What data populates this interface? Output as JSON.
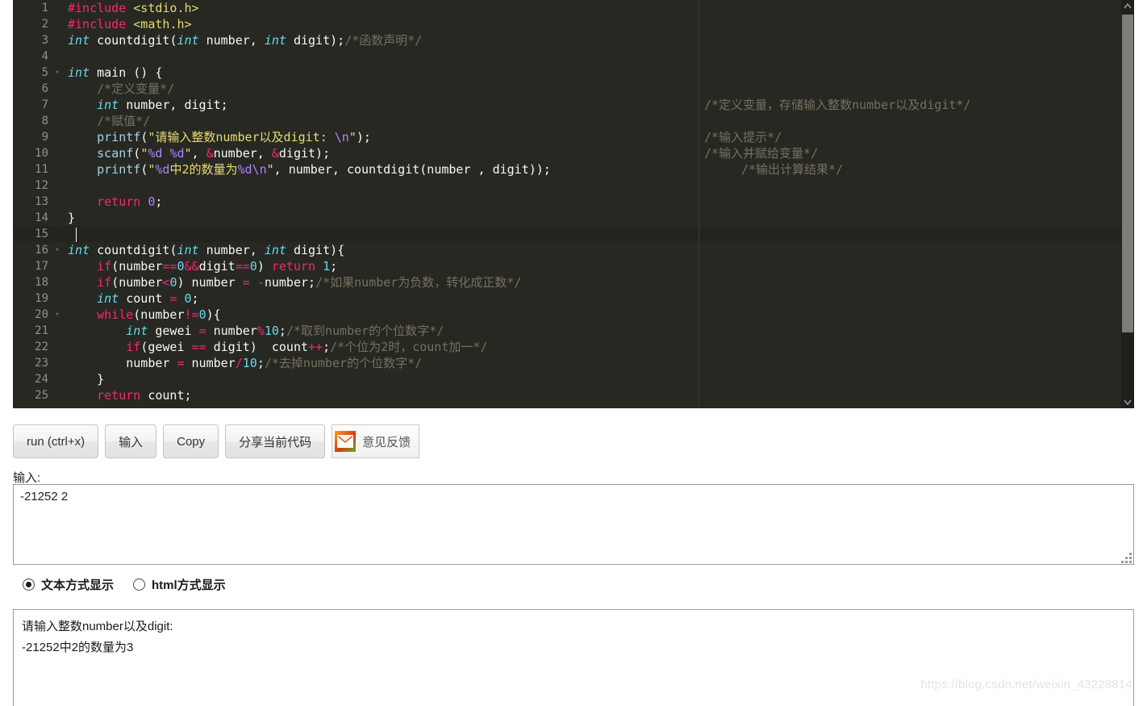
{
  "editor": {
    "background": "#272822",
    "gutter_color": "#8f908a",
    "active_line": 15,
    "first_line": 1,
    "last_visible_line": 25,
    "lines": [
      {
        "n": 1,
        "fold": false,
        "indent": 0
      },
      {
        "n": 2,
        "fold": false,
        "indent": 0
      },
      {
        "n": 3,
        "fold": false,
        "indent": 0
      },
      {
        "n": 4,
        "fold": false,
        "indent": 0
      },
      {
        "n": 5,
        "fold": true,
        "indent": 0
      },
      {
        "n": 6,
        "fold": false,
        "indent": 1
      },
      {
        "n": 7,
        "fold": false,
        "indent": 1
      },
      {
        "n": 8,
        "fold": false,
        "indent": 1
      },
      {
        "n": 9,
        "fold": false,
        "indent": 1
      },
      {
        "n": 10,
        "fold": false,
        "indent": 1
      },
      {
        "n": 11,
        "fold": false,
        "indent": 1
      },
      {
        "n": 12,
        "fold": false,
        "indent": 0
      },
      {
        "n": 13,
        "fold": false,
        "indent": 1
      },
      {
        "n": 14,
        "fold": false,
        "indent": 0
      },
      {
        "n": 15,
        "fold": false,
        "indent": 0
      },
      {
        "n": 16,
        "fold": true,
        "indent": 0
      },
      {
        "n": 17,
        "fold": false,
        "indent": 1
      },
      {
        "n": 18,
        "fold": false,
        "indent": 1
      },
      {
        "n": 19,
        "fold": false,
        "indent": 1
      },
      {
        "n": 20,
        "fold": true,
        "indent": 1
      },
      {
        "n": 21,
        "fold": false,
        "indent": 2
      },
      {
        "n": 22,
        "fold": false,
        "indent": 2
      },
      {
        "n": 23,
        "fold": false,
        "indent": 2
      },
      {
        "n": 24,
        "fold": false,
        "indent": 1
      },
      {
        "n": 25,
        "fold": false,
        "indent": 1
      }
    ],
    "code": [
      "#include <stdio.h>",
      "#include <math.h>",
      "int countdigit(int number, int digit);/*函数声明*/",
      "",
      "int main () {",
      "    /*定义变量*/",
      "    int number, digit;",
      "    /*赋值*/",
      "    printf(\"请输入整数number以及digit: \\n\");",
      "    scanf(\"%d %d\", &number, &digit);",
      "    printf(\"%d中2的数量为%d\\n\", number, countdigit(number , digit));",
      "",
      "    return 0;",
      "}",
      "",
      "int countdigit(int number, int digit){",
      "    if(number==0&&digit==0) return 1;",
      "    if(number<0) number = -number;/*如果number为负数，转化成正数*/",
      "    int count = 0;",
      "    while(number!=0){",
      "        int gewei = number%10;/*取到number的个位数字*/",
      "        if(gewei == digit)  count++;/*个位为2时，count加一*/",
      "        number = number/10;/*去掉number的个位数字*/",
      "    }",
      "    return count;"
    ],
    "right_comments": [
      {
        "line": 7,
        "indent": 0,
        "text": "/*定义变量，存储输入整数number以及digit*/"
      },
      {
        "line": 9,
        "indent": 0,
        "text": "/*输入提示*/"
      },
      {
        "line": 10,
        "indent": 0,
        "text": "/*输入并赋给变量*/"
      },
      {
        "line": 11,
        "indent": 3,
        "text": "/*输出计算结果*/"
      }
    ]
  },
  "scrollbar": {
    "up_arrow": "^",
    "down_arrow": "v"
  },
  "toolbar": {
    "run_label": "run (ctrl+x)",
    "input_label": "输入",
    "copy_label": "Copy",
    "share_label": "分享当前代码",
    "feedback_label": "意见反馈"
  },
  "stdin": {
    "label": "输入:",
    "value": "-21252 2",
    "placeholder": ""
  },
  "display_mode": {
    "options": [
      {
        "label": "文本方式显示",
        "checked": true
      },
      {
        "label": "html方式显示",
        "checked": false
      }
    ]
  },
  "output": {
    "lines": [
      "请输入整数number以及digit:",
      "-21252中2的数量为3"
    ]
  },
  "watermark": "https://blog.csdn.net/weixin_43228814"
}
